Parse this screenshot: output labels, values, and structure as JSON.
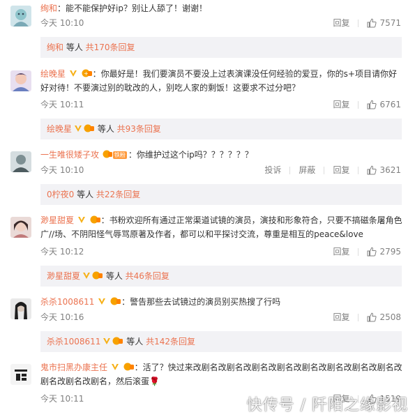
{
  "comments": [
    {
      "username": "绚和",
      "text": "：能不能保护好ip？别让人舔了！谢谢！",
      "time": "今天 10:10",
      "reply_label": "回复",
      "likes": "7571",
      "sub": {
        "user": "绚和",
        "suffix": " 等人 ",
        "count": "共170条回复"
      }
    },
    {
      "username": "绘晚星",
      "text": "：你最好是！我们要演员不要没上过表演课没任何经验的爱豆，你的s+项目请你好好对待！不要演过别的耽改的人，别吃人家的剩饭！这要求不过分吧？",
      "time": "今天 10:11",
      "reply_label": "回复",
      "likes": "6761",
      "sub": {
        "user": "绘晚星",
        "suffix": " 等人 ",
        "count": "共93条回复"
      }
    },
    {
      "username": "一生唯很矮子攻",
      "badge": "铁粉",
      "text": "：你维护过这个ip吗？？？？？？",
      "time": "今天 10:10",
      "report_label": "投诉",
      "block_label": "屏蔽",
      "reply_label": "回复",
      "likes": "3621",
      "sub": {
        "user": "0柠夜0",
        "suffix": " 等人 ",
        "count": "共22条回复"
      }
    },
    {
      "username": "渺星甜夏",
      "text": "：书粉欢迎所有通过正常渠道试镜的演员，演技和形象符合，只要不搞磁条屠角色广//场、不阴阳怪气辱骂原著及作者，都可以和平探讨交流，尊重是相互的peace&love",
      "time": "今天 10:12",
      "reply_label": "回复",
      "likes": "2795",
      "sub": {
        "user": "渺星甜夏",
        "suffix": " 等人 ",
        "count": "共46条回复"
      }
    },
    {
      "username": "杀杀1008611",
      "text": "：警告那些去试镜过的演员别买热搜了行吗",
      "time": "今天 10:16",
      "reply_label": "回复",
      "likes": "2508",
      "sub": {
        "user": "杀杀1008611",
        "suffix": " 等人 ",
        "count": "共142条回复"
      }
    },
    {
      "username": "鬼市扫黑办康主任",
      "text": "：活了？快过来改剧名改剧名改剧名改剧名改剧名改剧名改剧名改剧名改剧名改剧名改剧名，然后滚蛋🌹",
      "time": "今天 10:11",
      "reply_label": "回复",
      "likes": "1519"
    }
  ],
  "watermark": "快传号 / 阡陌之缘影视",
  "colors": {
    "username": "#eb7350",
    "meta": "#808080",
    "reply_bg": "#f2f2f5",
    "text": "#333333"
  }
}
